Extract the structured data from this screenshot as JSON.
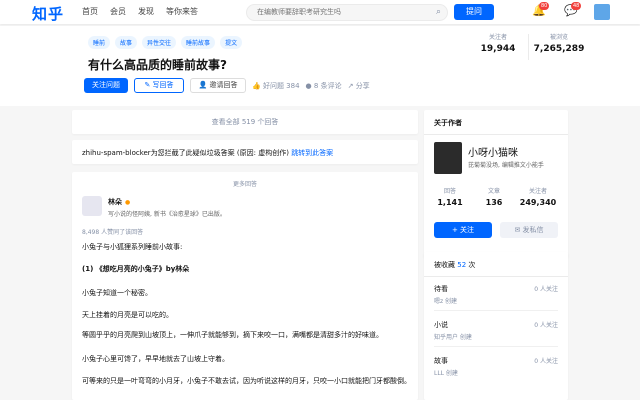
{
  "header": {
    "logo": "知乎",
    "nav": [
      "首页",
      "会员",
      "发现",
      "等你来答"
    ],
    "search_placeholder": "在编教师要辞职考研究生吗",
    "ask_label": "提问",
    "notif_badge": "80",
    "msg_badge": "48"
  },
  "question": {
    "tags": [
      "睡前",
      "故事",
      "异性交往",
      "睡前故事",
      "提文"
    ],
    "title": "有什么高品质的睡前故事?",
    "follow_label": "关注问题",
    "write_label": "写回答",
    "invite_label": "邀请回答",
    "good_label": "好问题 384",
    "comments_label": "8 条评论",
    "share_label": "分享",
    "followers_label": "关注者",
    "followers": "19,944",
    "views_label": "被浏览",
    "views": "7,265,289"
  },
  "all_answers": "查看全部 519 个回答",
  "spam": {
    "text": "zhihu-spam-blocker为您拦截了此疑似垃圾答案 (原因: 虚构创作) ",
    "link": "跳转到此答案"
  },
  "answer": {
    "more_label": "更多回答",
    "author": "林朵",
    "bio": "写小说的怪阿姨, 新书《治愈星球》已出版。",
    "agree": "8,498 人赞同了该回答",
    "paragraphs": [
      "小兔子与小狐狸系列睡前小故事:",
      "(1) 《想吃月亮的小兔子》by林朵",
      "小兔子知道一个秘密。",
      "天上挂着的月亮是可以吃的。",
      "等圆乎乎的月亮爬到山坡顶上，一伸爪子就能够到，摘下来咬一口，满嘴都是清甜多汁的好味道。",
      "小兔子心里可馋了，早早地就去了山坡上守着。",
      "可等来的只是一叶弯弯的小月牙，小兔子不敢去试，因为听说这样的月牙，只咬一小口就能把门牙都酸倒。"
    ]
  },
  "about": {
    "title": "关于作者",
    "name": "小呀小猫咪",
    "bio": "芘菊菊没场, 编辑推文小能手",
    "stats": [
      {
        "label": "回答",
        "value": "1,141"
      },
      {
        "label": "文章",
        "value": "136"
      },
      {
        "label": "关注者",
        "value": "249,340"
      }
    ],
    "follow_label": "+ 关注",
    "msg_label": "发私信"
  },
  "collect": {
    "title_prefix": "被收藏",
    "count": "52",
    "title_suffix": " 次",
    "items": [
      {
        "name": "待看",
        "creator": "嗯z 创建",
        "followers": "0 人关注"
      },
      {
        "name": "小说",
        "creator": "知乎用户 创建",
        "followers": "0 人关注"
      },
      {
        "name": "故事",
        "creator": "LLL 创建",
        "followers": "0 人关注"
      }
    ]
  }
}
